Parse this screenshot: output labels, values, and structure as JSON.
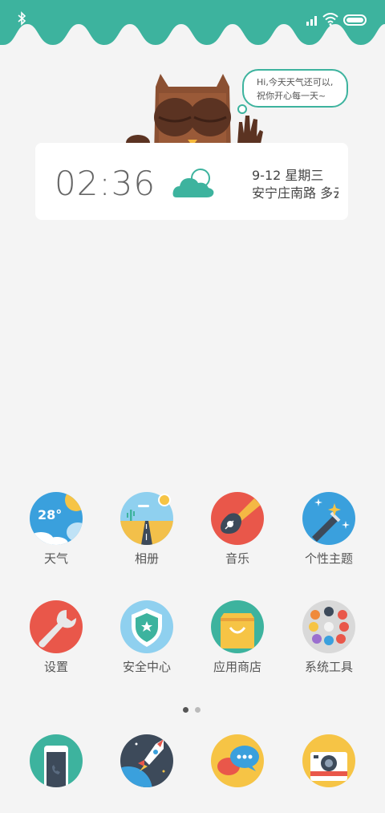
{
  "bubble": {
    "line1": "Hi,今天天气还可以,",
    "line2": "祝你开心每一天~"
  },
  "clock": {
    "time": "02:36",
    "date": "9-12  星期三",
    "location": "安宁庄南路 多云"
  },
  "weather_app_temp": "28°",
  "apps_row1": [
    {
      "label": "天气",
      "icon": "weather-icon"
    },
    {
      "label": "相册",
      "icon": "gallery-icon"
    },
    {
      "label": "音乐",
      "icon": "music-icon"
    },
    {
      "label": "个性主题",
      "icon": "themes-icon"
    }
  ],
  "apps_row2": [
    {
      "label": "设置",
      "icon": "settings-icon"
    },
    {
      "label": "安全中心",
      "icon": "security-icon"
    },
    {
      "label": "应用商店",
      "icon": "app-store-icon"
    },
    {
      "label": "系统工具",
      "icon": "system-tools-icon"
    }
  ],
  "dock": [
    {
      "icon": "phone-icon"
    },
    {
      "icon": "browser-icon"
    },
    {
      "icon": "messages-icon"
    },
    {
      "icon": "camera-icon"
    }
  ],
  "colors": {
    "accent": "#3db39e",
    "background": "#f4f4f4",
    "page_dot_active": "#555555",
    "page_dot_inactive": "#bbbbbb"
  },
  "pages": {
    "current": 1,
    "total": 2
  }
}
